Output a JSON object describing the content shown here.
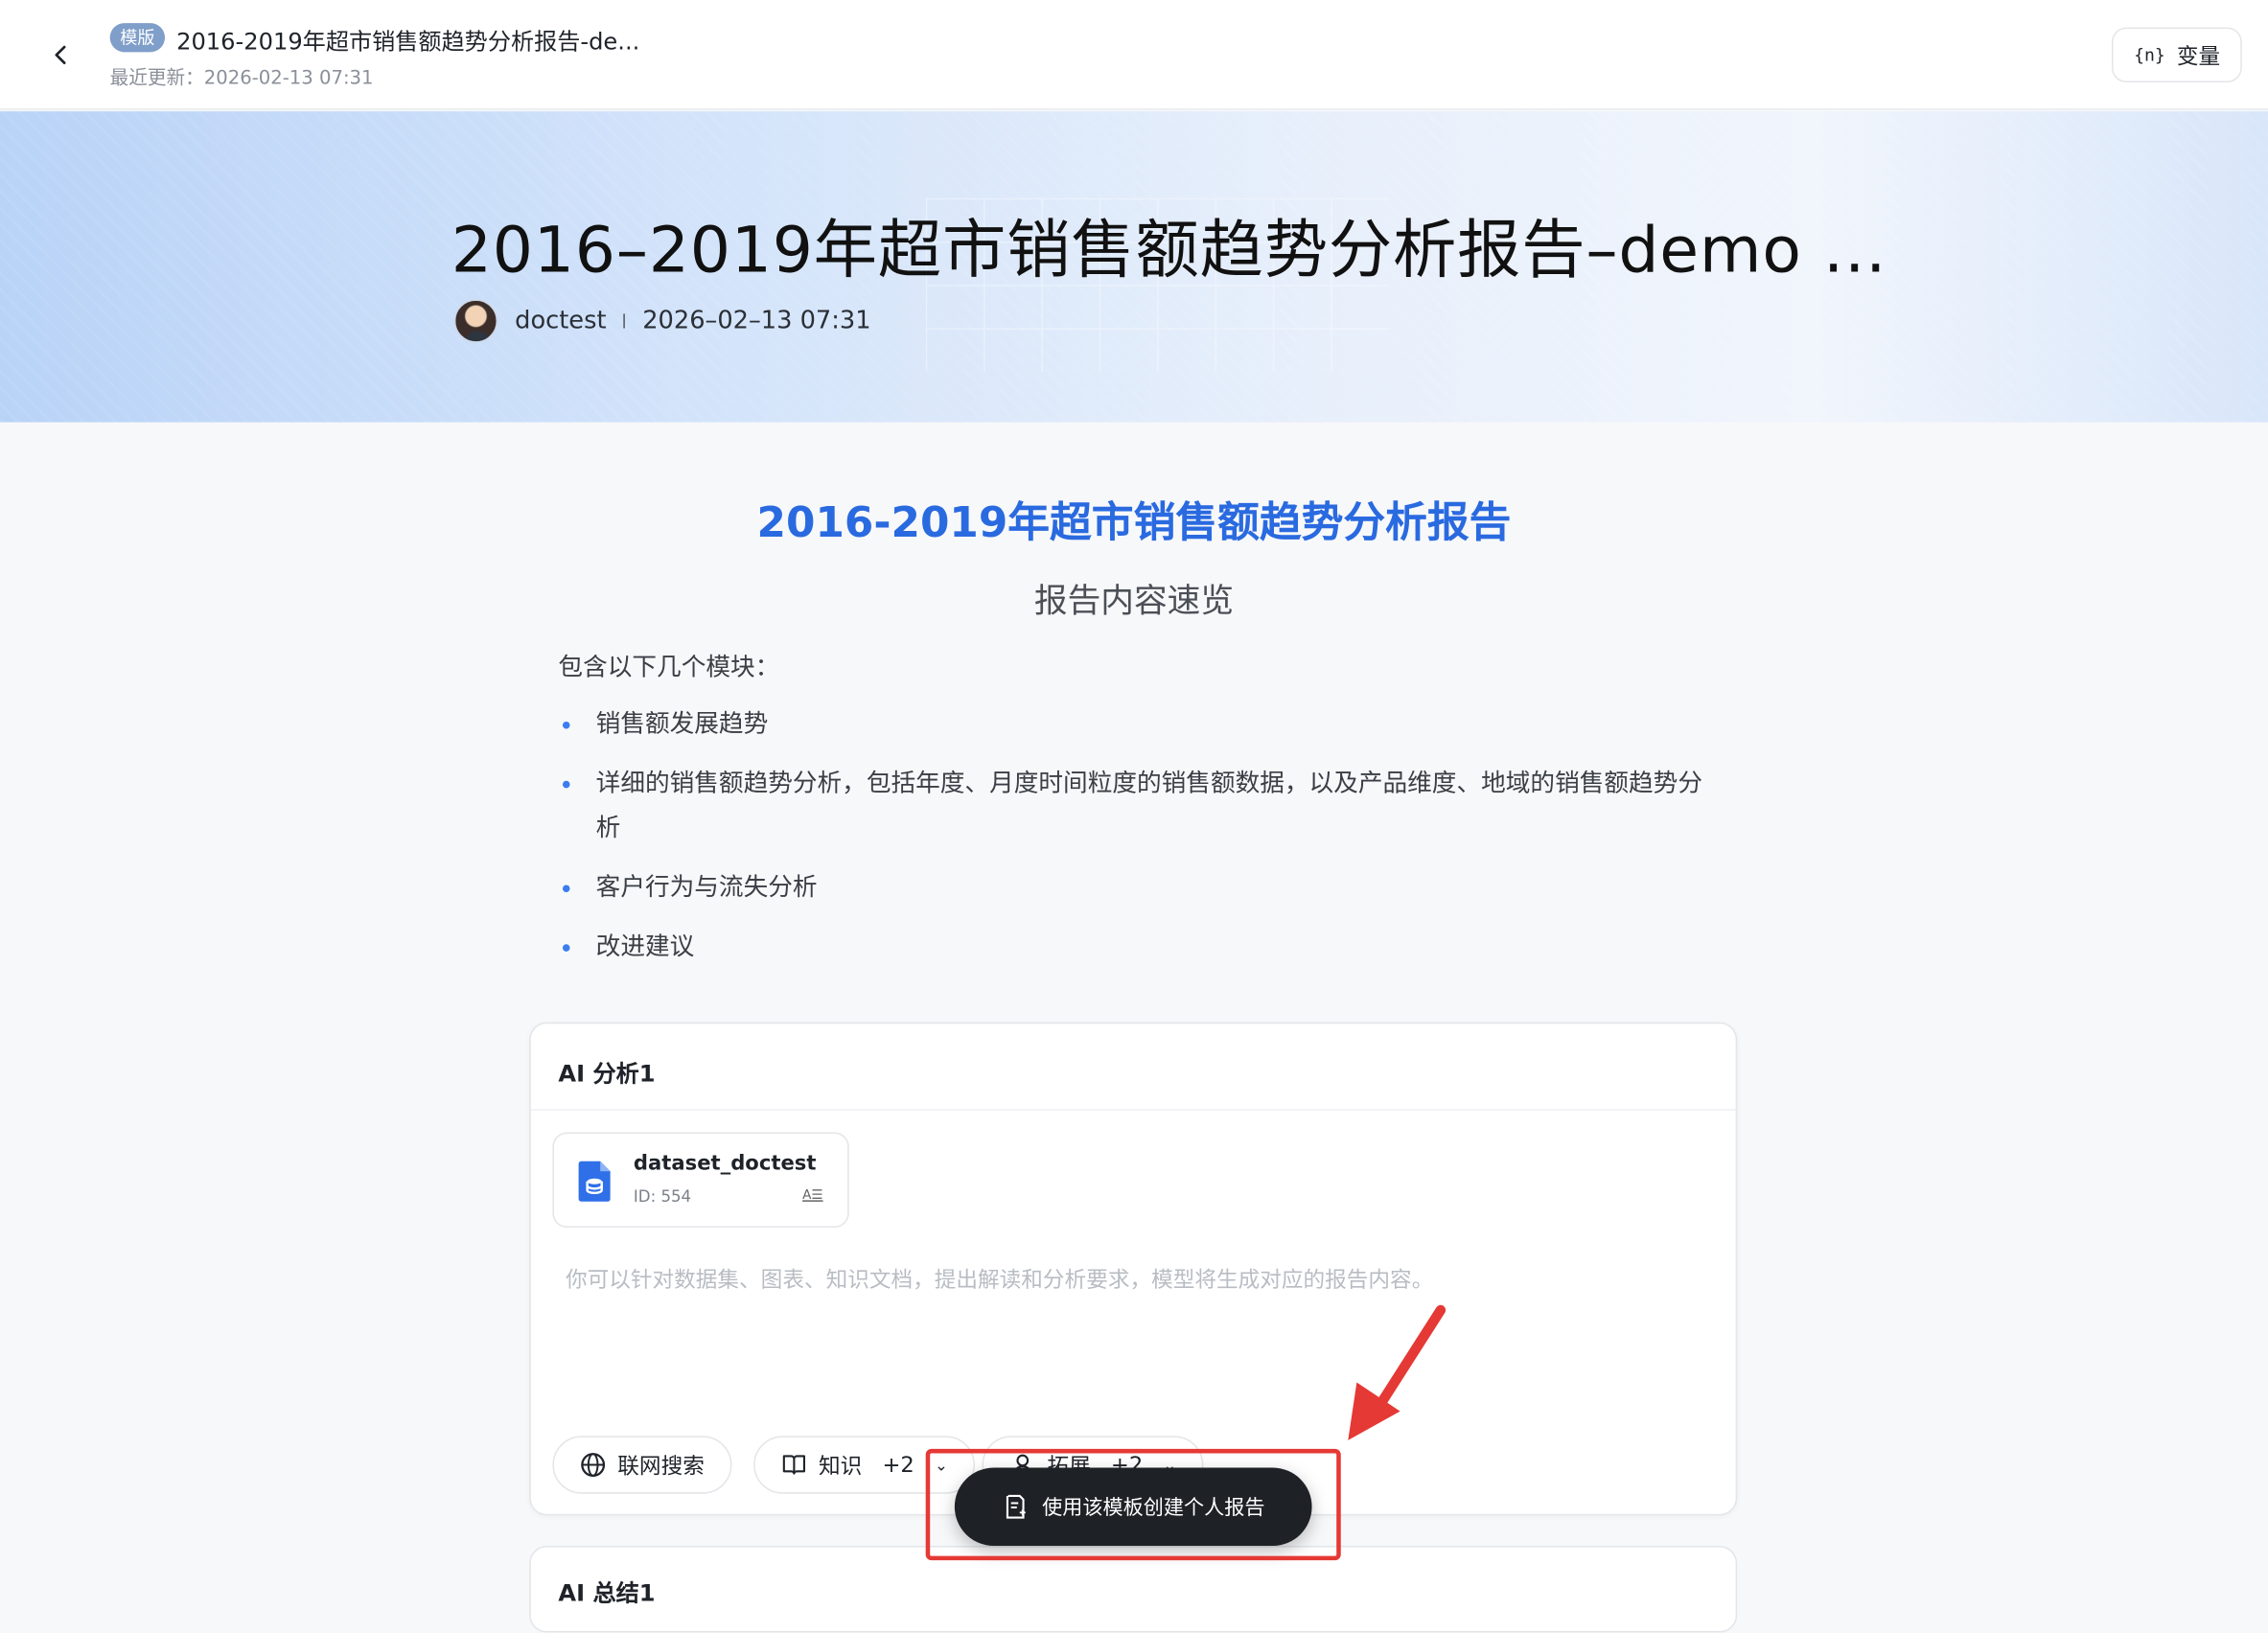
{
  "header": {
    "back_icon": "chevron-left-icon",
    "badge": "模版",
    "title": "2016-2019年超市销售额趋势分析报告-de...",
    "last_updated": "最近更新：2026-02-13 07:31",
    "variable_button": {
      "icon": "{n}",
      "label": "变量"
    }
  },
  "banner": {
    "title": "2016–2019年超市销售额趋势分析报告–demo …",
    "author": "doctest",
    "date": "2026–02–13 07:31"
  },
  "report": {
    "title": "2016-2019年超市销售额趋势分析报告",
    "subtitle": "报告内容速览",
    "intro": "包含以下几个模块：",
    "bullets": [
      "销售额发展趋势",
      "详细的销售额趋势分析，包括年度、月度时间粒度的销售额数据，以及产品维度、地域的销售额趋势分析",
      "客户行为与流失分析",
      "改进建议"
    ]
  },
  "ai_card": {
    "title": "AI 分析1",
    "dataset": {
      "name": "dataset_doctest",
      "id": "ID: 554",
      "tag": "A☰"
    },
    "prompt_placeholder": "你可以针对数据集、图表、知识文档，提出解读和分析要求，模型将生成对应的报告内容。",
    "chips": [
      {
        "icon": "globe-icon",
        "label": "联网搜索"
      },
      {
        "icon": "book-icon",
        "label": "知识",
        "extra": "+2"
      },
      {
        "icon": "extension-icon",
        "label": "拓展",
        "extra": "+2"
      }
    ]
  },
  "ai_card2": {
    "title": "AI 总结1"
  },
  "cta": {
    "icon": "create-report-icon",
    "label": "使用该模板创建个人报告"
  },
  "colors": {
    "accent": "#2a6ae0",
    "annotation": "#e53935",
    "cta_bg": "#1e2126"
  }
}
